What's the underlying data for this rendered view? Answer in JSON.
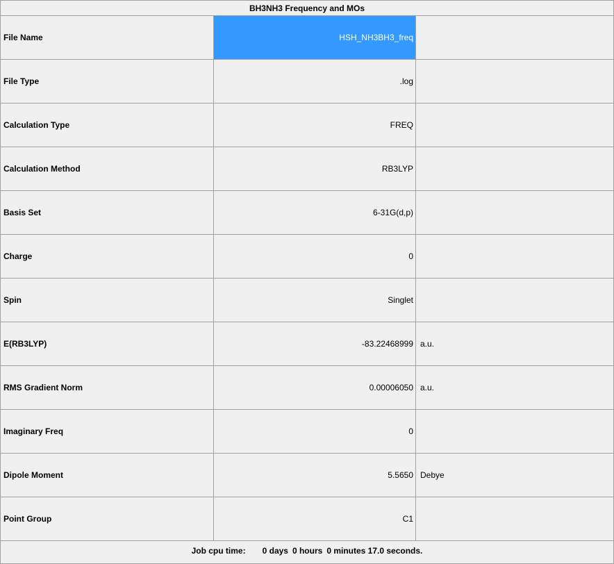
{
  "table": {
    "title": "BH3NH3 Frequency and MOs",
    "rows": [
      {
        "label": "File Name",
        "value": "HSH_NH3BH3_freq",
        "unit": ""
      },
      {
        "label": "File Type",
        "value": ".log",
        "unit": ""
      },
      {
        "label": "Calculation Type",
        "value": "FREQ",
        "unit": ""
      },
      {
        "label": "Calculation Method",
        "value": "RB3LYP",
        "unit": ""
      },
      {
        "label": "Basis Set",
        "value": "6-31G(d,p)",
        "unit": ""
      },
      {
        "label": "Charge",
        "value": "0",
        "unit": ""
      },
      {
        "label": "Spin",
        "value": "Singlet",
        "unit": ""
      },
      {
        "label": "E(RB3LYP)",
        "value": "-83.22468999",
        "unit": "a.u."
      },
      {
        "label": "RMS Gradient Norm",
        "value": "0.00006050",
        "unit": "a.u."
      },
      {
        "label": "Imaginary Freq",
        "value": "0",
        "unit": ""
      },
      {
        "label": "Dipole Moment",
        "value": "5.5650",
        "unit": "Debye"
      },
      {
        "label": "Point Group",
        "value": "C1",
        "unit": ""
      }
    ]
  },
  "footer": {
    "label": "Job cpu time:",
    "days": "0 days",
    "hours": "0 hours",
    "minutes": "0 minutes",
    "seconds": "17.0 seconds."
  },
  "colors": {
    "selection": "#3399ff",
    "background": "#f0f0f0",
    "gridline": "#a0a0a0"
  }
}
